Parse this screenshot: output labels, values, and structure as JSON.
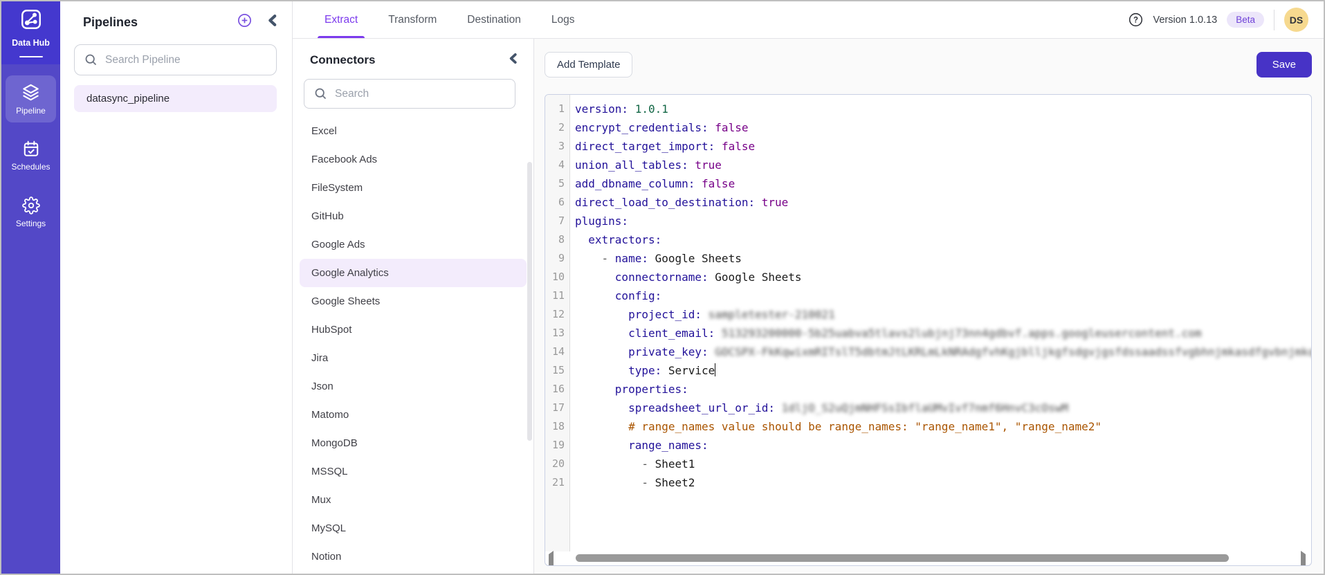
{
  "colors": {
    "accent": "#7C3AED",
    "sidebar_bg": "#5348C7",
    "sidebar_logo_bg": "#4438CE",
    "sidebar_active_bg": "rgba(255,255,255,0.16)",
    "selected_item_bg": "#F3ECFC",
    "save_button_bg": "#4733C6",
    "beta_badge_bg": "#ECE6FA",
    "beta_badge_text": "#6F42D8",
    "avatar_bg": "#F6D98F",
    "scrollbar_thumb": "#9a9a9a",
    "tok_key": "#221199",
    "tok_num": "#116644",
    "tok_kw": "#770088",
    "tok_comment": "#aa5500"
  },
  "sidebar": {
    "brand": "Data Hub",
    "items": [
      {
        "id": "pipeline",
        "label": "Pipeline",
        "icon": "layers-icon",
        "active": true
      },
      {
        "id": "schedules",
        "label": "Schedules",
        "icon": "calendar-check-icon",
        "active": false
      },
      {
        "id": "settings",
        "label": "Settings",
        "icon": "gear-icon",
        "active": false
      }
    ]
  },
  "pipelines": {
    "title": "Pipelines",
    "search_placeholder": "Search Pipeline",
    "items": [
      {
        "label": "datasync_pipeline",
        "selected": true
      }
    ]
  },
  "topbar": {
    "tabs": [
      {
        "label": "Extract",
        "active": true
      },
      {
        "label": "Transform",
        "active": false
      },
      {
        "label": "Destination",
        "active": false
      },
      {
        "label": "Logs",
        "active": false
      }
    ],
    "version": "Version 1.0.13",
    "beta": "Beta",
    "avatar_initials": "DS"
  },
  "connectors": {
    "title": "Connectors",
    "search_placeholder": "Search",
    "selected": "Google Analytics",
    "items": [
      "Excel",
      "Facebook Ads",
      "FileSystem",
      "GitHub",
      "Google Ads",
      "Google Analytics",
      "Google Sheets",
      "HubSpot",
      "Jira",
      "Json",
      "Matomo",
      "MongoDB",
      "MSSQL",
      "Mux",
      "MySQL",
      "Notion"
    ]
  },
  "toolbar": {
    "add_template_label": "Add Template",
    "save_label": "Save"
  },
  "editor": {
    "lines": [
      {
        "segments": [
          [
            "key",
            "version:"
          ],
          [
            "plain",
            " "
          ],
          [
            "num",
            "1.0.1"
          ]
        ]
      },
      {
        "segments": [
          [
            "key",
            "encrypt_credentials:"
          ],
          [
            "plain",
            " "
          ],
          [
            "kw",
            "false"
          ]
        ]
      },
      {
        "segments": [
          [
            "key",
            "direct_target_import:"
          ],
          [
            "plain",
            " "
          ],
          [
            "kw",
            "false"
          ]
        ]
      },
      {
        "segments": [
          [
            "key",
            "union_all_tables:"
          ],
          [
            "plain",
            " "
          ],
          [
            "kw",
            "true"
          ]
        ]
      },
      {
        "segments": [
          [
            "key",
            "add_dbname_column:"
          ],
          [
            "plain",
            " "
          ],
          [
            "kw",
            "false"
          ]
        ]
      },
      {
        "segments": [
          [
            "key",
            "direct_load_to_destination:"
          ],
          [
            "plain",
            " "
          ],
          [
            "kw",
            "true"
          ]
        ]
      },
      {
        "segments": [
          [
            "key",
            "plugins:"
          ]
        ]
      },
      {
        "segments": [
          [
            "plain",
            "  "
          ],
          [
            "key",
            "extractors:"
          ]
        ]
      },
      {
        "segments": [
          [
            "plain",
            "    "
          ],
          [
            "meta",
            "- "
          ],
          [
            "key",
            "name:"
          ],
          [
            "plain",
            " Google Sheets"
          ]
        ]
      },
      {
        "segments": [
          [
            "plain",
            "      "
          ],
          [
            "key",
            "connectorname:"
          ],
          [
            "plain",
            " Google Sheets"
          ]
        ]
      },
      {
        "segments": [
          [
            "plain",
            "      "
          ],
          [
            "key",
            "config:"
          ]
        ]
      },
      {
        "segments": [
          [
            "plain",
            "        "
          ],
          [
            "key",
            "project_id:"
          ],
          [
            "plain",
            " "
          ],
          [
            "blur",
            "sampletester-210021"
          ]
        ]
      },
      {
        "segments": [
          [
            "plain",
            "        "
          ],
          [
            "key",
            "client_email:"
          ],
          [
            "plain",
            " "
          ],
          [
            "blur",
            "513293200000-5b25uabva5tlavs2lubjnj73nn4gdbvf.apps.googleusercontent.com"
          ]
        ]
      },
      {
        "segments": [
          [
            "plain",
            "        "
          ],
          [
            "key",
            "private_key:"
          ],
          [
            "plain",
            " "
          ],
          [
            "blur",
            "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NRAdgfvhKgjblljkgfsdgvjgsfdssaadssfvgbhnjmkasdfgvbnjmkqwertyuiop,f"
          ]
        ]
      },
      {
        "segments": [
          [
            "plain",
            "        "
          ],
          [
            "key",
            "type:"
          ],
          [
            "plain",
            " Service"
          ]
        ],
        "cursor": true
      },
      {
        "segments": [
          [
            "plain",
            "      "
          ],
          [
            "key",
            "properties:"
          ]
        ]
      },
      {
        "segments": [
          [
            "plain",
            "        "
          ],
          [
            "key",
            "spreadsheet_url_or_id:"
          ],
          [
            "plain",
            " "
          ],
          [
            "blur",
            "1dljO_S2uQjmNHFSsIbflaUMvIvf7nmf6HnvC3cOswM"
          ]
        ]
      },
      {
        "segments": [
          [
            "plain",
            "        "
          ],
          [
            "comment",
            "# range_names value should be range_names: \"range_name1\", \"range_name2\""
          ]
        ]
      },
      {
        "segments": [
          [
            "plain",
            "        "
          ],
          [
            "key",
            "range_names:"
          ]
        ]
      },
      {
        "segments": [
          [
            "plain",
            "          "
          ],
          [
            "meta",
            "- "
          ],
          [
            "plain",
            "Sheet1"
          ]
        ]
      },
      {
        "segments": [
          [
            "plain",
            "          "
          ],
          [
            "meta",
            "- "
          ],
          [
            "plain",
            "Sheet2"
          ]
        ]
      }
    ]
  }
}
